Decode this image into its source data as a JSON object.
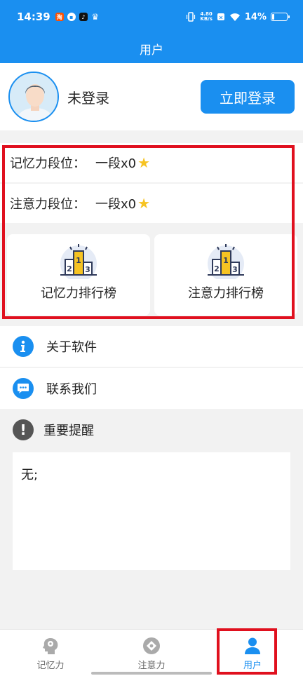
{
  "status_bar": {
    "time": "14:39",
    "net_speed_value": "4.80",
    "net_speed_unit": "KB/s",
    "battery_percent": "14%",
    "battery_level": 0.14
  },
  "header": {
    "title": "用户"
  },
  "profile": {
    "username": "未登录",
    "login_button": "立即登录"
  },
  "ranks": {
    "memory": {
      "label": "记忆力段位：",
      "value": "一段x0"
    },
    "attention": {
      "label": "注意力段位：",
      "value": "一段x0"
    }
  },
  "boards": {
    "memory": "记忆力排行榜",
    "attention": "注意力排行榜"
  },
  "menu": {
    "about": "关于软件",
    "contact": "联系我们"
  },
  "reminder": {
    "title": "重要提醒",
    "content": "无;"
  },
  "tabs": {
    "memory": "记忆力",
    "attention": "注意力",
    "user": "用户"
  },
  "colors": {
    "primary": "#1a8ff0",
    "highlight_frame": "#e0101e",
    "star": "#f6c322"
  }
}
